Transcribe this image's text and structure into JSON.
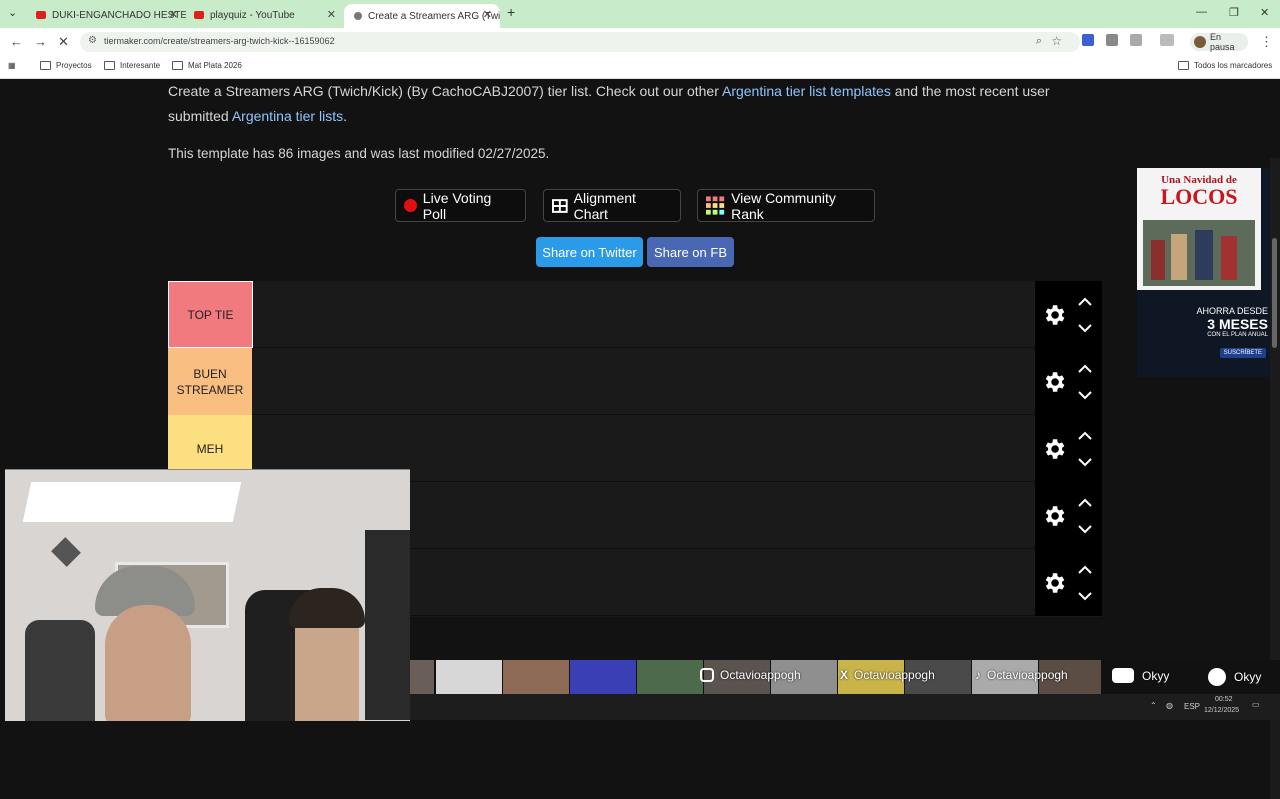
{
  "browser": {
    "tabs": [
      {
        "title": "DUKI-ENGANCHADO HESTERO",
        "color": "#e0211b"
      },
      {
        "title": "playquiz - YouTube",
        "color": "#e0211b"
      },
      {
        "title": "Create a Streamers ARG (Twich/",
        "color": "#777777"
      }
    ],
    "url": "tiermaker.com/create/streamers-arg-twich-kick--16159062",
    "profile_label": "En pausa",
    "bookmarks": [
      "Proyectos",
      "Interesante",
      "Mat Plata 2026"
    ],
    "all_bookmarks": "Todos los marcadores"
  },
  "intro": {
    "line1_a": "Create a Streamers ARG (Twich/Kick) (By CachoCABJ2007) tier list. Check out our other ",
    "link1": "Argentina tier list templates",
    "line1_b": " and the most recent user submitted ",
    "link2": "Argentina tier lists",
    "line1_c": ".",
    "stats": "This template has 86 images and was last modified 02/27/2025."
  },
  "buttons": {
    "live_poll": "Live Voting Poll",
    "alignment": "Alignment Chart",
    "community": "View Community Rank",
    "twitter": "Share on Twitter",
    "facebook": "Share on FB"
  },
  "colors": {
    "twitter": "#2b9be9",
    "facebook": "#4a67b3"
  },
  "tiers": [
    {
      "label": "TOP TIE",
      "color": "#f17a7f"
    },
    {
      "label": "BUEN STREAMER",
      "color": "#f9bf80"
    },
    {
      "label": "MEH",
      "color": "#fcdf80"
    },
    {
      "label": "",
      "color": "#fcf880"
    },
    {
      "label": "",
      "color": "#bff97f"
    }
  ],
  "stream_overlay": {
    "instagram": "Octavioappogh",
    "x": "Octavioappogh",
    "tiktok": "Octavioappogh",
    "youtube": "Okyy",
    "spotify": "Okyy"
  },
  "ad": {
    "title_line1": "Una Navidad de",
    "title_line2": "LOCOS",
    "promo_line1": "AHORRA DESDE",
    "promo_line2": "3 MESES",
    "promo_line3": "CON EL PLAN ANUAL",
    "cta": "SUSCRÍBETE"
  },
  "taskbar": {
    "lang": "ESP",
    "time": "00:52",
    "date": "12/12/2025"
  }
}
